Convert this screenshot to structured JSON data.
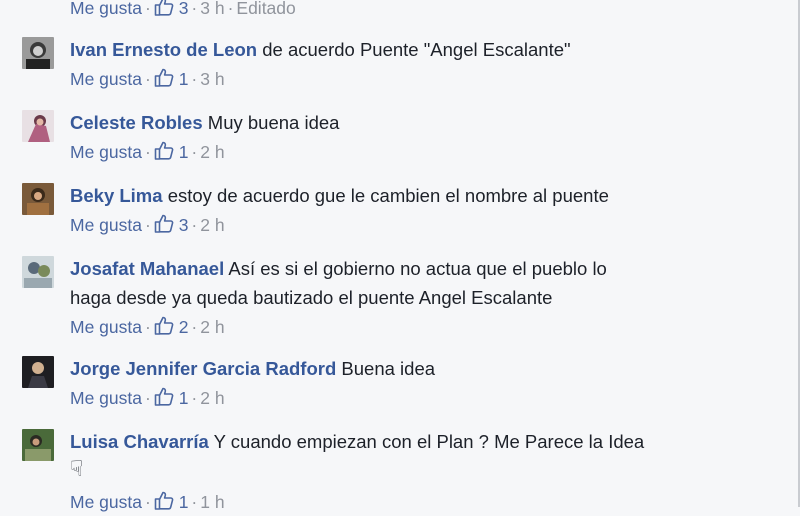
{
  "like_label": "Me gusta",
  "separator": "·",
  "top": {
    "likes": "3",
    "time": "3 h",
    "edited": "Editado"
  },
  "comments": [
    {
      "author": "Ivan Ernesto de Leon",
      "text": "de acuerdo Puente \"Angel Escalante\"",
      "likes": "1",
      "time": "3 h"
    },
    {
      "author": "Celeste Robles",
      "text": "Muy buena idea",
      "likes": "1",
      "time": "2 h"
    },
    {
      "author": "Beky Lima",
      "text": "estoy de acuerdo gue le cambien el nombre al puente",
      "likes": "3",
      "time": "2 h"
    },
    {
      "author": "Josafat Mahanael",
      "text": "Así es si el gobierno no actua que el pueblo lo",
      "text2": "haga desde ya queda bautizado el puente Angel Escalante",
      "likes": "2",
      "time": "2 h"
    },
    {
      "author": "Jorge Jennifer Garcia Radford",
      "text": "Buena idea",
      "likes": "1",
      "time": "2 h"
    },
    {
      "author": "Luisa Chavarría",
      "text": "Y cuando empiezan con el Plan ? Me Parece la Idea",
      "emoji": "☟",
      "likes": "1",
      "time": "1 h"
    }
  ],
  "colors": {
    "link": "#365899",
    "meta": "#90949c",
    "background": "#f6f7f9"
  }
}
